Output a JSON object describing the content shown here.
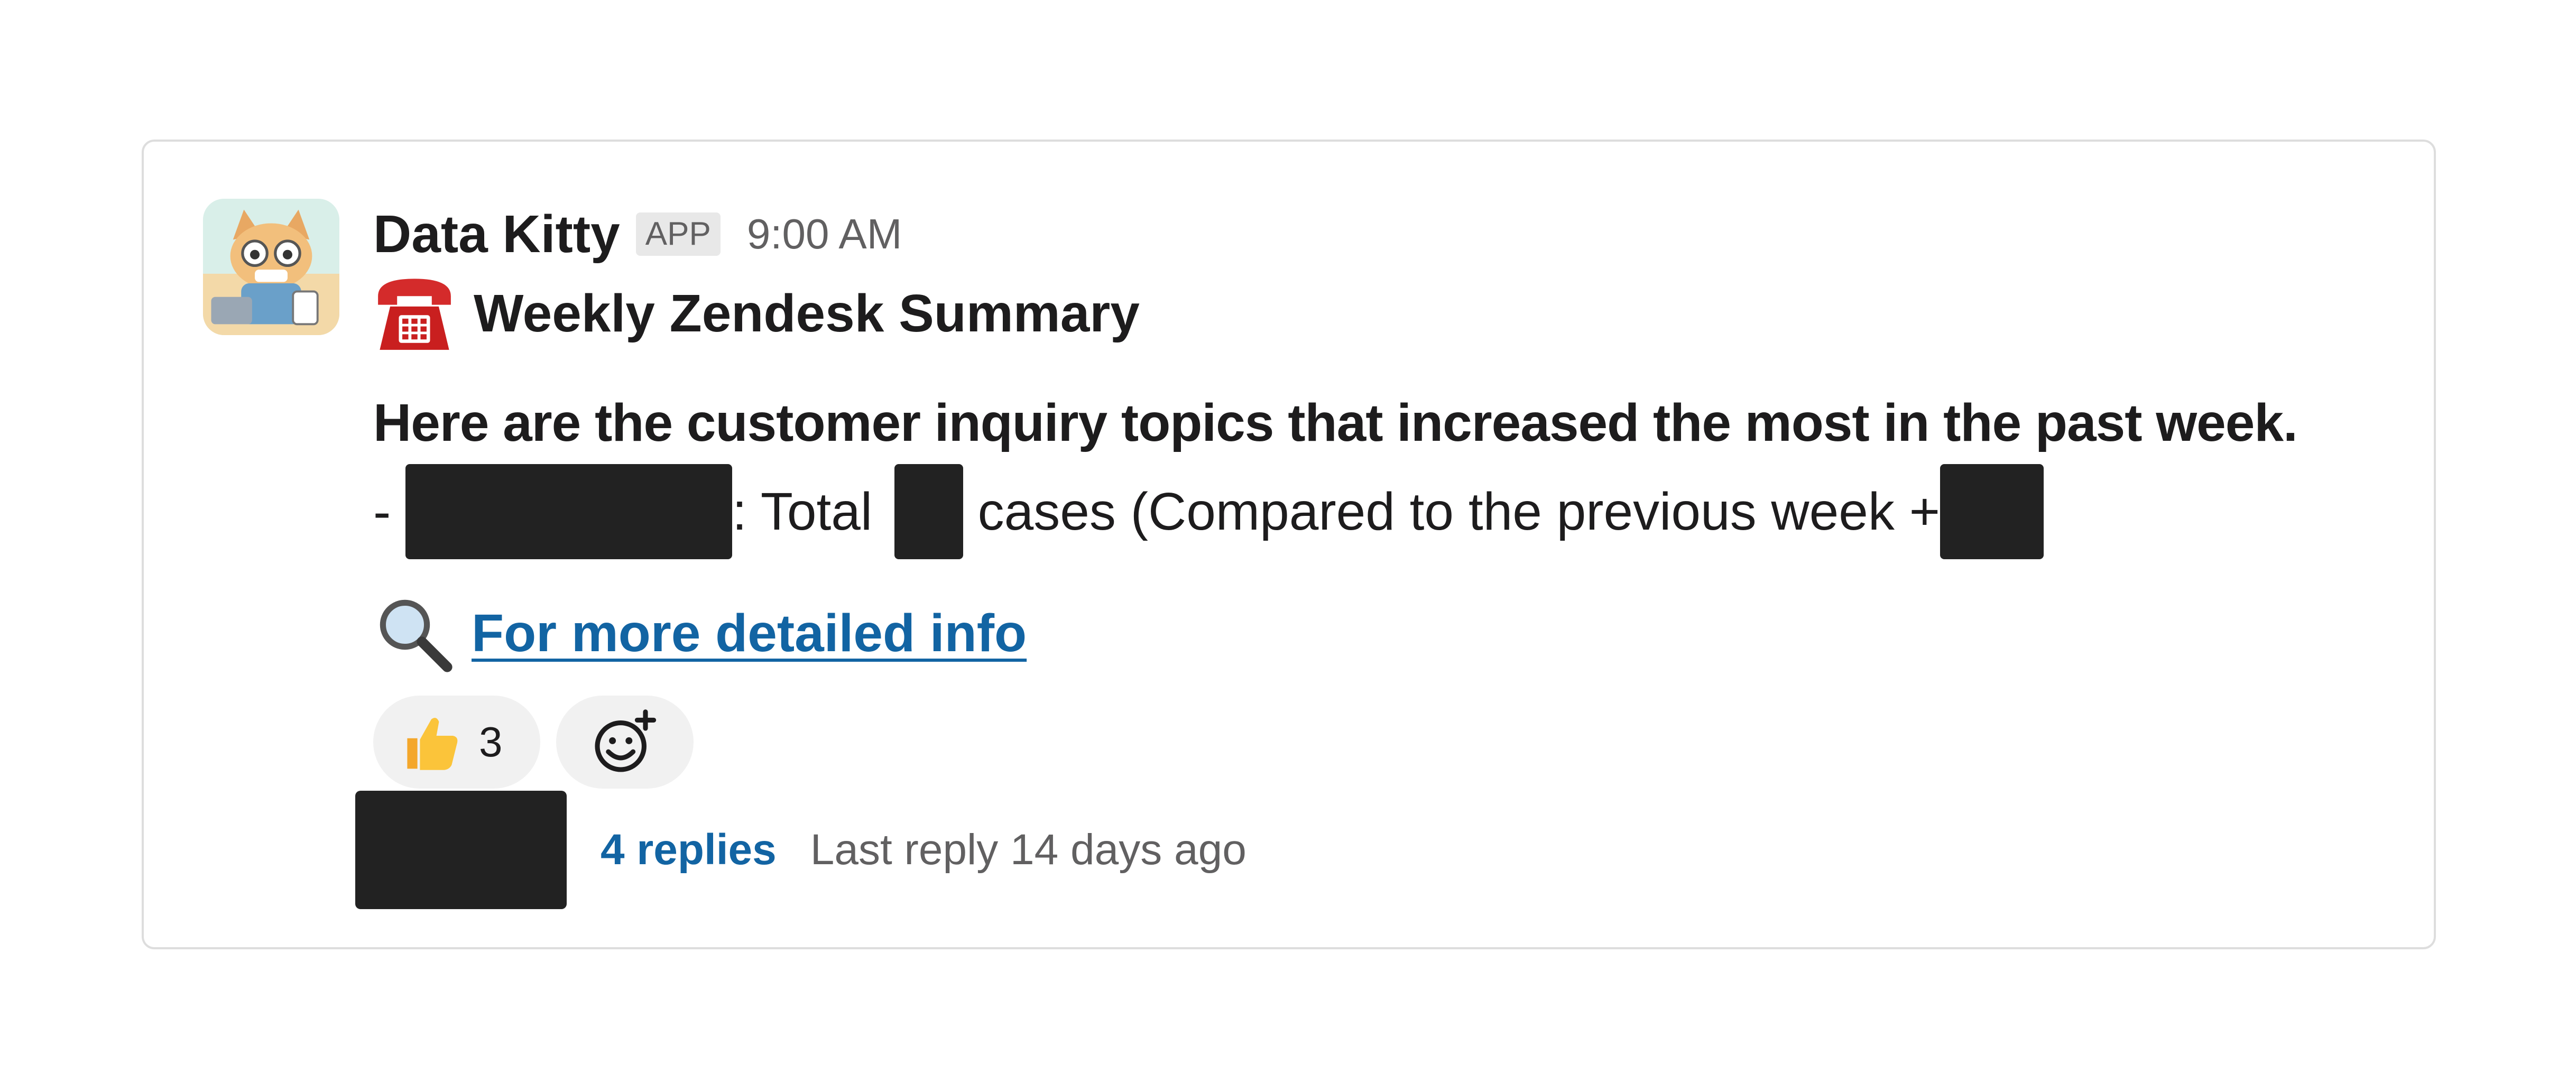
{
  "message": {
    "sender": "Data Kitty",
    "badge": "APP",
    "time": "9:00 AM",
    "title": "Weekly Zendesk Summary",
    "title_icon": "telephone-icon",
    "intro": "Here are the customer inquiry topics that increased the most in the past week.",
    "stat": {
      "prefix": "- ",
      "total_label": ": Total ",
      "cases_label": " cases (Compared to the previous week +"
    },
    "link": {
      "icon": "magnifier-icon",
      "label": "For more detailed info"
    }
  },
  "reactions": [
    {
      "icon": "thumbs-up-icon",
      "count": "3"
    },
    {
      "icon": "add-reaction-icon"
    }
  ],
  "thread": {
    "replies": "4 replies",
    "last_reply": "Last reply 14 days ago"
  },
  "colors": {
    "link": "#1264a3",
    "muted": "#616061",
    "redaction": "#222222",
    "border": "#dddddd"
  }
}
